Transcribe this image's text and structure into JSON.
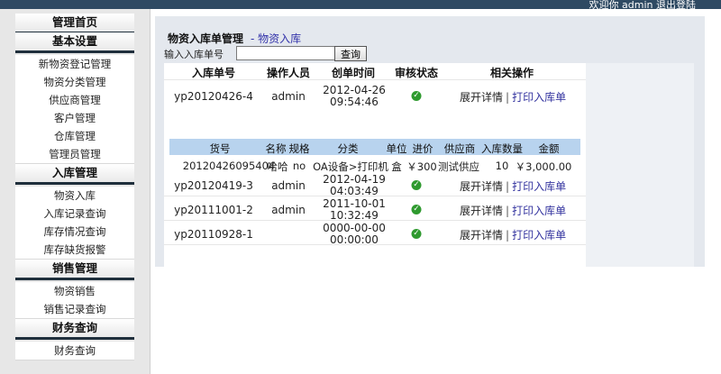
{
  "header": {
    "right_text": "欢迎你 admin   退出登陆"
  },
  "sidebar": {
    "sections": [
      {
        "title": "管理首页",
        "items": []
      },
      {
        "title": "基本设置",
        "items": [
          "新物资登记管理",
          "物资分类管理",
          "供应商管理",
          "客户管理",
          "仓库管理",
          "管理员管理"
        ]
      },
      {
        "title": "入库管理",
        "items": [
          "物资入库",
          "入库记录查询",
          "库存情况查询",
          "库存缺货报警"
        ]
      },
      {
        "title": "销售管理",
        "items": [
          "物资销售",
          "销售记录查询"
        ]
      },
      {
        "title": "财务查询",
        "items": [
          "财务查询"
        ]
      }
    ]
  },
  "page": {
    "title": "物资入库单管理",
    "subtitle": "- 物资入库",
    "search_label": "输入入库单号",
    "search_value": "",
    "search_button": "查询"
  },
  "table": {
    "headers": [
      "入库单号",
      "操作人员",
      "创单时间",
      "审核状态",
      "相关操作"
    ],
    "actions": {
      "expand": "展开详情",
      "separator": "|",
      "print": "打印入库单"
    },
    "rows": [
      {
        "id": "yp20120426-4",
        "operator": "admin",
        "date": "2012-04-26",
        "time": "09:54:46",
        "approved": true
      },
      {
        "id": "yp20120419-3",
        "operator": "admin",
        "date": "2012-04-19",
        "time": "04:03:49",
        "approved": true
      },
      {
        "id": "yp20111001-2",
        "operator": "admin",
        "date": "2011-10-01",
        "time": "10:32:49",
        "approved": true
      },
      {
        "id": "yp20110928-1",
        "operator": "",
        "date": "0000-00-00",
        "time": "00:00:00",
        "approved": true
      }
    ]
  },
  "detail": {
    "headers": [
      "货号",
      "名称",
      "规格",
      "分类",
      "单位",
      "进价",
      "供应商",
      "入库数量",
      "金额"
    ],
    "row": [
      "20120426095404",
      "哈哈",
      "no",
      "OA设备>打印机",
      "盒",
      "￥300",
      "测试供应",
      "10",
      "￥3,000.00"
    ]
  },
  "colors": {
    "topbar": "#2f4a63",
    "section_bar": "#1f2f3c",
    "detail_header": "#b8d3ee",
    "link": "#33339f",
    "ok": "#2f9a2f"
  }
}
